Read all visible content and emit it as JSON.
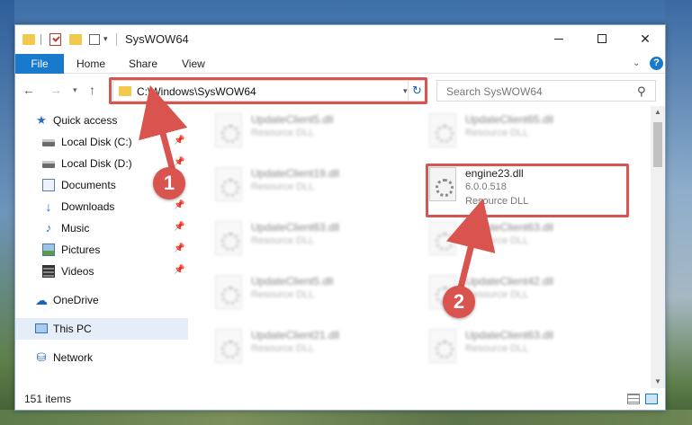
{
  "window": {
    "title": "SysWOW64",
    "controls": {
      "minimize": "minimize",
      "maximize": "maximize",
      "close": "close"
    }
  },
  "ribbon": {
    "tabs": [
      {
        "label": "File",
        "active": true
      },
      {
        "label": "Home"
      },
      {
        "label": "Share"
      },
      {
        "label": "View"
      }
    ]
  },
  "address": {
    "path": "C:\\Windows\\SysWOW64"
  },
  "search": {
    "placeholder": "Search SysWOW64"
  },
  "sidebar": {
    "items": [
      {
        "label": "Quick access",
        "icon": "star-icon"
      },
      {
        "label": "Local Disk (C:)",
        "icon": "disk-icon",
        "pinned": true
      },
      {
        "label": "Local Disk (D:)",
        "icon": "disk-icon",
        "pinned": true
      },
      {
        "label": "Documents",
        "icon": "document-icon",
        "pinned": true
      },
      {
        "label": "Downloads",
        "icon": "download-icon",
        "pinned": true
      },
      {
        "label": "Music",
        "icon": "music-icon",
        "pinned": true
      },
      {
        "label": "Pictures",
        "icon": "pictures-icon",
        "pinned": true
      },
      {
        "label": "Videos",
        "icon": "videos-icon",
        "pinned": true
      },
      {
        "label": "OneDrive",
        "icon": "cloud-icon"
      },
      {
        "label": "This PC",
        "icon": "pc-icon",
        "selected": true
      },
      {
        "label": "Network",
        "icon": "network-icon"
      }
    ]
  },
  "files": [
    {
      "name": "UpdateClient5.dll",
      "type": "Resource DLL"
    },
    {
      "name": "UpdateClient65.dll",
      "type": "Resource DLL"
    },
    {
      "name": "UpdateClient19.dll",
      "type": "Resource DLL"
    },
    {
      "name": "engine23.dll",
      "version": "6.0.0.518",
      "type": "Resource DLL",
      "highlighted": true
    },
    {
      "name": "UpdateClient63.dll",
      "type": "Resource DLL"
    },
    {
      "name": "UpdateClient63.dll",
      "type": "Resource DLL"
    },
    {
      "name": "UpdateClient5.dll",
      "type": "Resource DLL"
    },
    {
      "name": "UpdateClient42.dll",
      "type": "Resource DLL"
    },
    {
      "name": "UpdateClient21.dll",
      "type": "Resource DLL"
    },
    {
      "name": "UpdateClient63.dll",
      "type": "Resource DLL"
    }
  ],
  "status": {
    "item_count": "151 items"
  },
  "annotations": {
    "step1": "1",
    "step2": "2",
    "color": "#d9534f"
  },
  "colors": {
    "accent": "#1979ca",
    "highlight": "#d9534f"
  }
}
